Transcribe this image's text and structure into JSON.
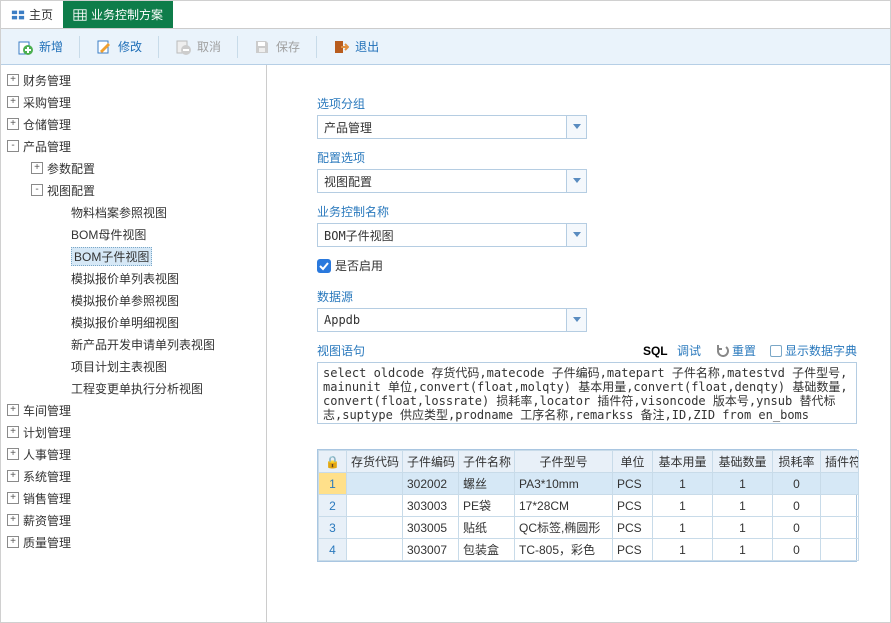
{
  "tabs": {
    "home": "主页",
    "current": "业务控制方案"
  },
  "toolbar": {
    "add": "新增",
    "edit": "修改",
    "cancel": "取消",
    "save": "保存",
    "exit": "退出"
  },
  "tree": {
    "n0": "财务管理",
    "n1": "采购管理",
    "n2": "仓储管理",
    "n3": "产品管理",
    "n3_0": "参数配置",
    "n3_1": "视图配置",
    "n3_1_0": "物料档案参照视图",
    "n3_1_1": "BOM母件视图",
    "n3_1_2": "BOM子件视图",
    "n3_1_3": "模拟报价单列表视图",
    "n3_1_4": "模拟报价单参照视图",
    "n3_1_5": "模拟报价单明细视图",
    "n3_1_6": "新产品开发申请单列表视图",
    "n3_1_7": "项目计划主表视图",
    "n3_1_8": "工程变更单执行分析视图",
    "n4": "车间管理",
    "n5": "计划管理",
    "n6": "人事管理",
    "n7": "系统管理",
    "n8": "销售管理",
    "n9": "薪资管理",
    "n10": "质量管理"
  },
  "form": {
    "group_label": "选项分组",
    "group_value": "产品管理",
    "option_label": "配置选项",
    "option_value": "视图配置",
    "name_label": "业务控制名称",
    "name_value": "BOM子件视图",
    "enabled_label": "是否启用",
    "ds_label": "数据源",
    "ds_value": "Appdb",
    "sql_label": "视图语句",
    "sql_debug_b": "SQL",
    "sql_debug": "调试",
    "sql_reset": "重置",
    "sql_dict": "显示数据字典",
    "sql_value": "select oldcode 存货代码,matecode 子件编码,matepart 子件名称,matestvd 子件型号,mainunit 单位,convert(float,molqty) 基本用量,convert(float,denqty) 基础数量,convert(float,lossrate) 损耗率,locator 插件符,visoncode 版本号,ynsub 替代标志,suptype 供应类型,prodname 工序名称,remarkss 备注,ID,ZID from en_boms"
  },
  "grid": {
    "lock": "🔒",
    "cols": {
      "c0": "存货代码",
      "c1": "子件编码",
      "c2": "子件名称",
      "c3": "子件型号",
      "c4": "单位",
      "c5": "基本用量",
      "c6": "基础数量",
      "c7": "损耗率",
      "c8": "插件符"
    },
    "rows": [
      {
        "n": "1",
        "c1": "302002",
        "c2": "螺丝",
        "c3": "PA3*10mm",
        "c4": "PCS",
        "c5": "1",
        "c6": "1",
        "c7": "0"
      },
      {
        "n": "2",
        "c1": "303003",
        "c2": "PE袋",
        "c3": "17*28CM",
        "c4": "PCS",
        "c5": "1",
        "c6": "1",
        "c7": "0"
      },
      {
        "n": "3",
        "c1": "303005",
        "c2": "贴纸",
        "c3": "QC标签,椭圆形",
        "c4": "PCS",
        "c5": "1",
        "c6": "1",
        "c7": "0"
      },
      {
        "n": "4",
        "c1": "303007",
        "c2": "包装盒",
        "c3": "TC-805，彩色",
        "c4": "PCS",
        "c5": "1",
        "c6": "1",
        "c7": "0"
      }
    ]
  }
}
